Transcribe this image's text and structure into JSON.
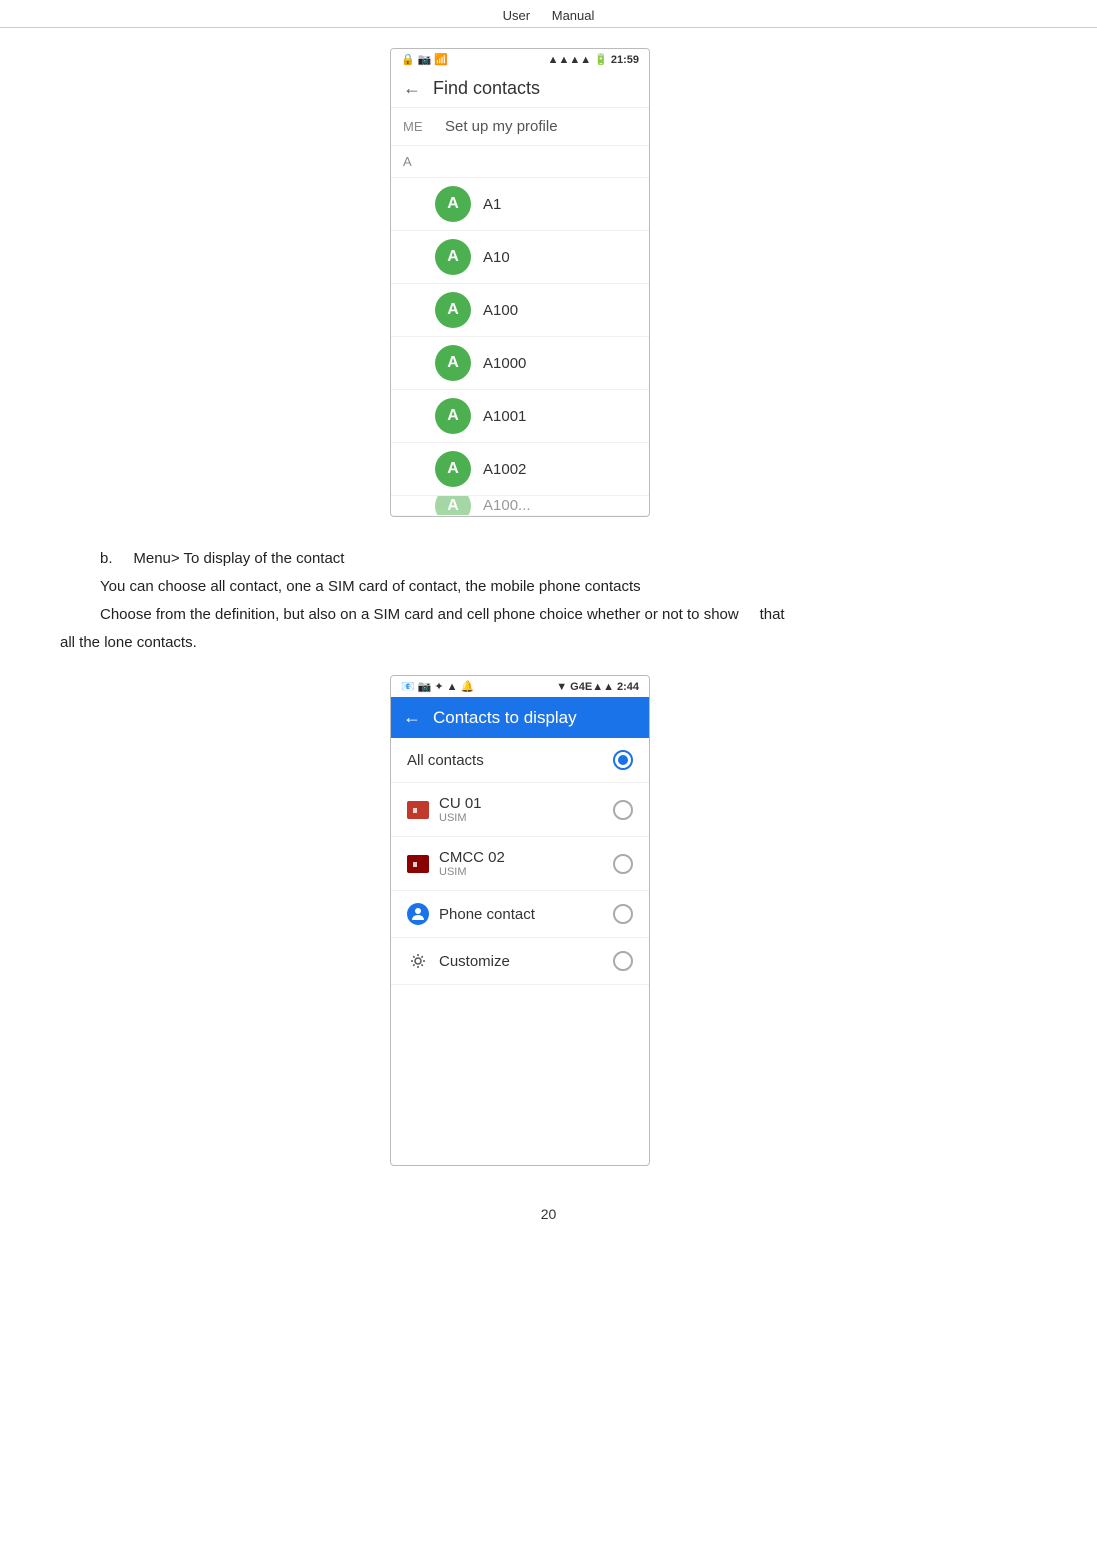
{
  "header": {
    "left": "User",
    "right": "Manual"
  },
  "phone1": {
    "statusBar": {
      "left": "🔒 📷 📶",
      "time": "21:59",
      "signal": "▲▲▲▲",
      "battery": "🔋"
    },
    "appBar": {
      "backLabel": "←",
      "title": "Find contacts"
    },
    "meSection": {
      "label": "ME",
      "profileText": "Set up my profile"
    },
    "sectionA": "A",
    "contacts": [
      {
        "initial": "A",
        "name": "A1"
      },
      {
        "initial": "A",
        "name": "A10"
      },
      {
        "initial": "A",
        "name": "A100"
      },
      {
        "initial": "A",
        "name": "A1000"
      },
      {
        "initial": "A",
        "name": "A1001"
      },
      {
        "initial": "A",
        "name": "A1002"
      }
    ]
  },
  "bodyText": {
    "bulletLabel": "b.",
    "bulletText": "Menu> To display of the contact",
    "line1": "You can choose all contact, one a SIM card of contact, the mobile phone contacts",
    "line2": "Choose from the definition, but also on a SIM card and cell phone choice whether or not to show",
    "line2end": "that",
    "line3": "all the lone contacts."
  },
  "phone2": {
    "statusBar": {
      "icons": "📧 📷 ✦ ▲ 🔔",
      "network": "▼ G4E▲▲",
      "time": "2:44"
    },
    "appBar": {
      "backLabel": "←",
      "title": "Contacts to display"
    },
    "options": [
      {
        "text": "All contacts",
        "sub": "",
        "icon": "none",
        "selected": true
      },
      {
        "text": "CU 01",
        "sub": "USIM",
        "icon": "sim1",
        "selected": false
      },
      {
        "text": "CMCC 02",
        "sub": "USIM",
        "icon": "sim2",
        "selected": false
      },
      {
        "text": "Phone contact",
        "sub": "",
        "icon": "person",
        "selected": false
      },
      {
        "text": "Customize",
        "sub": "",
        "icon": "customize",
        "selected": false
      }
    ]
  },
  "pageNumber": "20"
}
